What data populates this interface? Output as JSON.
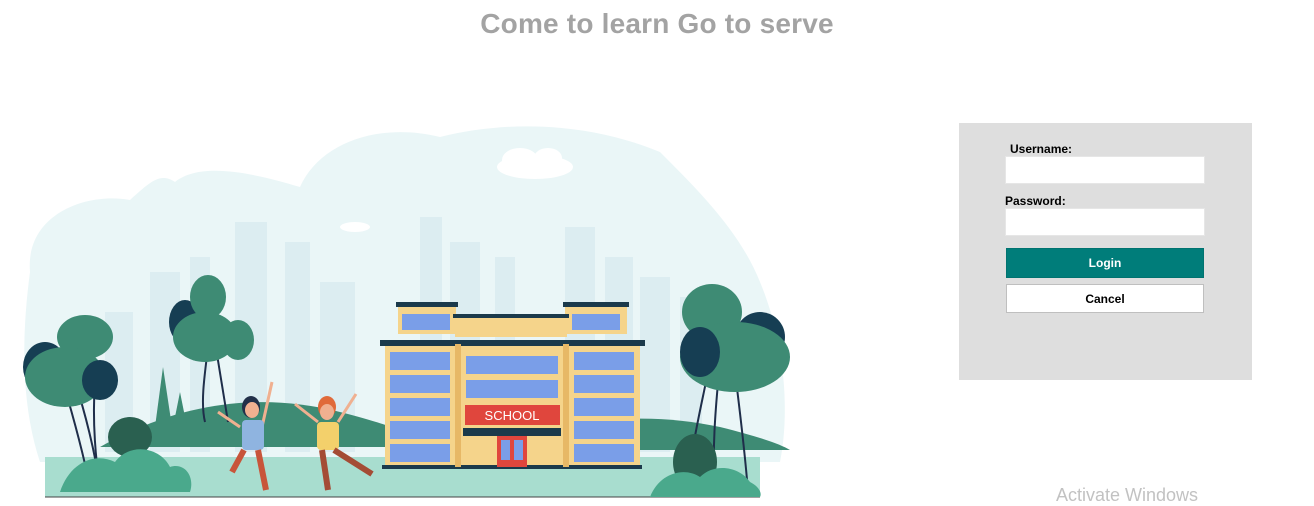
{
  "header": {
    "title": "Come to learn Go to serve"
  },
  "illustration": {
    "sign_text": "SCHOOL"
  },
  "login": {
    "username_label": "Username:",
    "username_value": "",
    "password_label": "Password:",
    "password_value": "",
    "login_label": "Login",
    "cancel_label": "Cancel"
  },
  "watermark": {
    "text": "Activate Windows"
  },
  "colors": {
    "accent": "#007d7a",
    "title": "#a3a3a3",
    "panel": "#dedede",
    "school_sign": "#e0463d"
  }
}
